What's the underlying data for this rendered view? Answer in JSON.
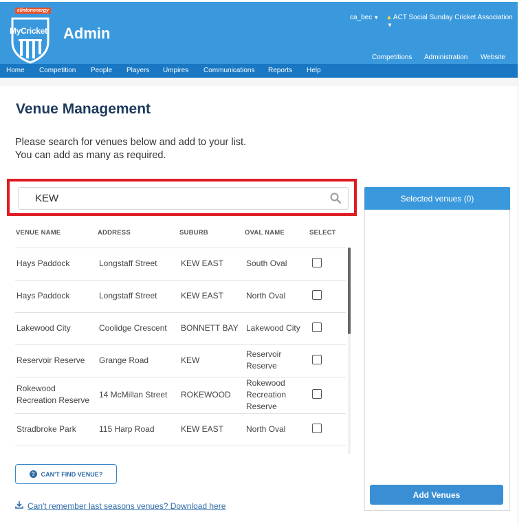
{
  "header": {
    "sponsor": "clintonenergy",
    "brand": "MyCricket",
    "title": "Admin",
    "user": "ca_bec",
    "association": "ACT Social Sunday Cricket Association",
    "top_links": [
      "Competitions",
      "Administration",
      "Website"
    ]
  },
  "nav": [
    "Home",
    "Competition",
    "People",
    "Players",
    "Umpires",
    "Communications",
    "Reports",
    "Help"
  ],
  "page": {
    "title": "Venue Management",
    "intro_line1": "Please search for venues below and add to your list.",
    "intro_line2": "You can add as many as required."
  },
  "search": {
    "value": "KEW"
  },
  "table": {
    "headers": [
      "VENUE NAME",
      "ADDRESS",
      "SUBURB",
      "OVAL NAME",
      "SELECT"
    ],
    "rows": [
      {
        "venue_l1": "Hays Paddock",
        "venue_l2": "",
        "address": "Longstaff Street",
        "suburb": "KEW EAST",
        "oval_l1": "South Oval",
        "oval_l2": "",
        "oval_l3": "",
        "selected": false
      },
      {
        "venue_l1": "Hays Paddock",
        "venue_l2": "",
        "address": "Longstaff Street",
        "suburb": "KEW EAST",
        "oval_l1": "North Oval",
        "oval_l2": "",
        "oval_l3": "",
        "selected": false
      },
      {
        "venue_l1": "Lakewood City",
        "venue_l2": "",
        "address": "Coolidge Crescent",
        "suburb": "BONNETT BAY",
        "oval_l1": "Lakewood City",
        "oval_l2": "",
        "oval_l3": "",
        "selected": false
      },
      {
        "venue_l1": "Reservoir Reserve",
        "venue_l2": "",
        "address": "Grange Road",
        "suburb": "KEW",
        "oval_l1": "Reservoir",
        "oval_l2": "Reserve",
        "oval_l3": "",
        "selected": false
      },
      {
        "venue_l1": "Rokewood",
        "venue_l2": "Recreation Reserve",
        "address": "14 McMillan Street",
        "suburb": "ROKEWOOD",
        "oval_l1": "Rokewood",
        "oval_l2": "Recreation",
        "oval_l3": "Reserve",
        "selected": false
      },
      {
        "venue_l1": "Stradbroke Park",
        "venue_l2": "",
        "address": "115 Harp Road",
        "suburb": "KEW EAST",
        "oval_l1": "North Oval",
        "oval_l2": "",
        "oval_l3": "",
        "selected": false
      }
    ]
  },
  "actions": {
    "cant_find": "CAN'T FIND VENUE?",
    "download": "Can't remember last seasons venues? Download here"
  },
  "selected_panel": {
    "title": "Selected venues (0)",
    "add_button": "Add Venues"
  },
  "colors": {
    "header_blue": "#3a99dd",
    "nav_blue": "#1977c3",
    "highlight_red": "#dd1c24",
    "title_navy": "#1c3a5c"
  }
}
